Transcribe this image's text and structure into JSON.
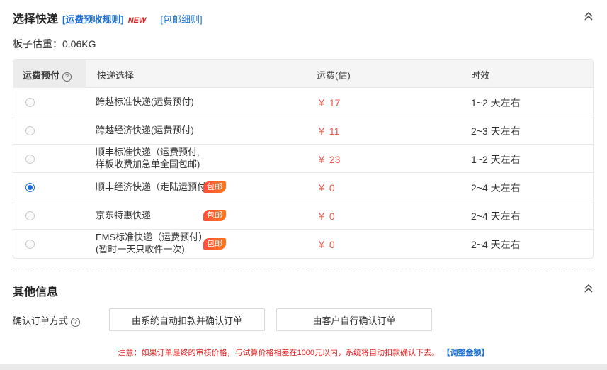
{
  "shipping": {
    "title": "选择快递",
    "rules_link": "[运费预收规则]",
    "new_badge": "NEW",
    "free_link": "[包邮细则]",
    "weight": "板子估重：0.06KG",
    "headers": {
      "prepay": "运费预付",
      "help": "?",
      "courier": "快递选择",
      "fee": "运费(估)",
      "time": "时效"
    },
    "rows": [
      {
        "name_lines": [
          "跨越标准快递(运费预付)"
        ],
        "badge": "",
        "price": "￥ 17",
        "time": "1~2 天左右",
        "selected": false,
        "price_color": "#e85a4f"
      },
      {
        "name_lines": [
          "跨越经济快递(运费预付)"
        ],
        "badge": "",
        "price": "￥ 11",
        "time": "2~3 天左右",
        "selected": false,
        "price_color": "#e85a4f"
      },
      {
        "name_lines": [
          "顺丰标准快递（运费预付,",
          "样板收费加急单全国包邮)"
        ],
        "badge": "",
        "price": "￥ 23",
        "time": "1~2 天左右",
        "selected": false,
        "price_color": "#e85a4f"
      },
      {
        "name_lines": [
          "顺丰经济快递（走陆运预付"
        ],
        "badge": "包邮",
        "price": "￥ 0",
        "time": "2~4 天左右",
        "selected": true,
        "price_color": "#e85a4f"
      },
      {
        "name_lines": [
          "京东特惠快递"
        ],
        "badge": "包邮",
        "price": "￥ 0",
        "time": "2~4 天左右",
        "selected": false,
        "price_color": "#e85a4f"
      },
      {
        "name_lines": [
          "EMS标准快递（运费预付）",
          "(暂时一天只收件一次)"
        ],
        "badge": "包邮",
        "price": "￥ 0",
        "time": "2~4 天左右",
        "selected": false,
        "price_color": "#e85a4f"
      }
    ]
  },
  "other": {
    "title": "其他信息",
    "confirm_label": "确认订单方式",
    "help": "?",
    "btn_auto": "由系统自动扣款并确认订单",
    "btn_manual": "由客户自行确认订单",
    "notice": "注意：如果订单最终的审核价格，与试算价格相差在1000元以内，系统将自动扣款确认下去。",
    "adjust_link": "【调整金额】"
  },
  "colors": {
    "accent": "#1a6fd6",
    "danger": "#e0211f",
    "price": "#e85a4f"
  }
}
